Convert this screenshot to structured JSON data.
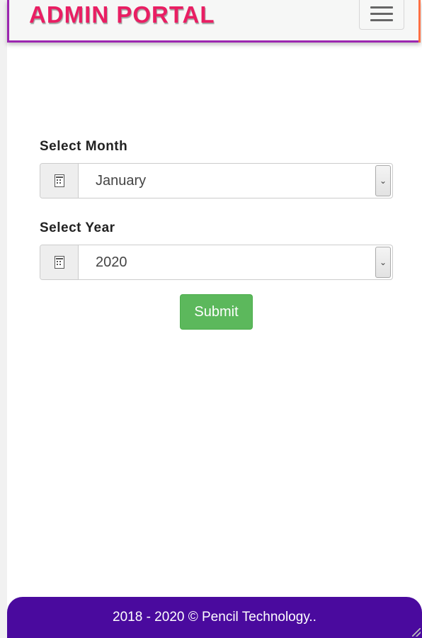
{
  "header": {
    "brand": "ADMIN PORTAL",
    "menu_icon": "hamburger-menu-icon"
  },
  "form": {
    "month": {
      "label": "Select Month",
      "icon": "calendar-icon",
      "value": "January"
    },
    "year": {
      "label": "Select Year",
      "icon": "calendar-icon",
      "value": "2020"
    },
    "submit_label": "Submit"
  },
  "footer": {
    "text": "2018 - 2020 © Pencil Technology.."
  },
  "colors": {
    "brand": "#e91e63",
    "navbar_border": "#9c27b0",
    "submit": "#5cb85c",
    "footer": "#4a0a9e"
  }
}
